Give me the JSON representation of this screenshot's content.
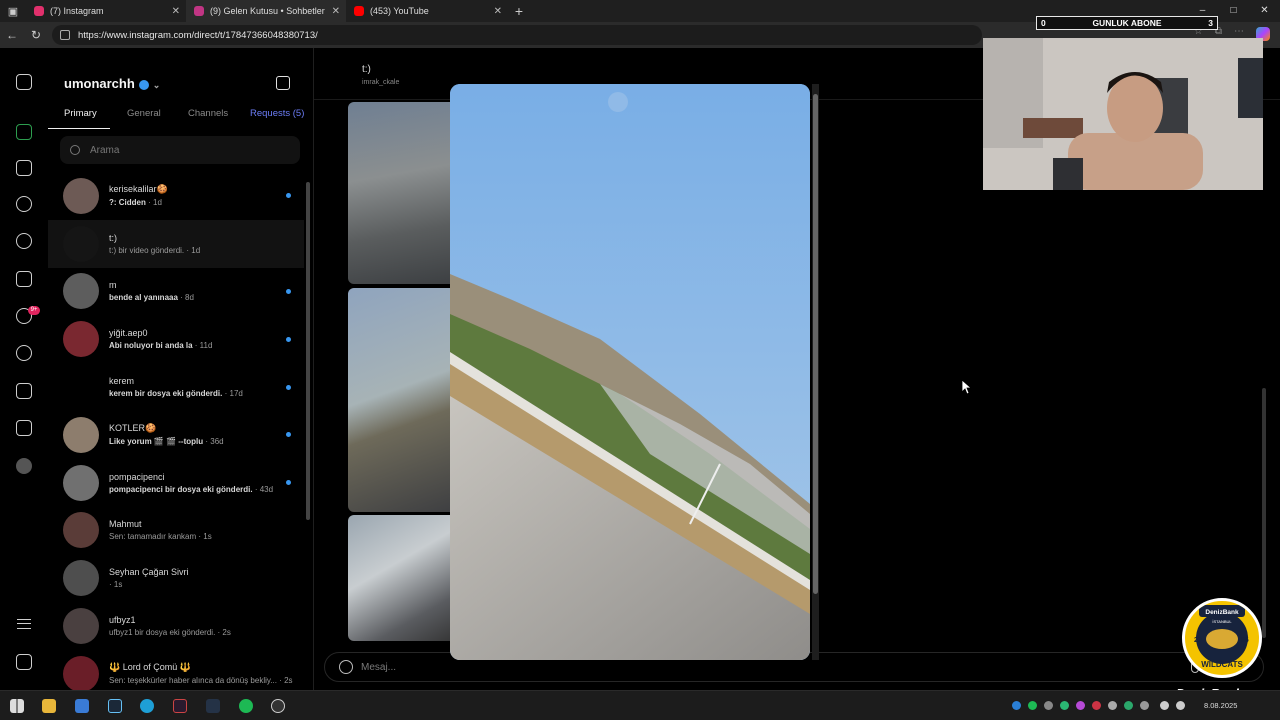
{
  "browser": {
    "tabs": [
      {
        "title": "(7) Instagram",
        "favicon_color": "#e1306c"
      },
      {
        "title": "(9) Gelen Kutusu • Sohbetler",
        "favicon_color": "#c13584"
      },
      {
        "title": "(453) YouTube",
        "favicon_color": "#ff0000"
      }
    ],
    "new_tab": "+",
    "url": "https://www.instagram.com/direct/t/17847366048380713/",
    "window_controls": {
      "minimize": "–",
      "maximize": "□",
      "close": "✕"
    }
  },
  "instagram": {
    "account_name": "umonarchh",
    "filters": {
      "primary": "Primary",
      "general": "General",
      "channels": "Channels",
      "requests": "Requests (5)"
    },
    "search_placeholder": "Arama",
    "notification_badge": "9+",
    "conversations": [
      {
        "name": "kerisekalilar🍪",
        "preview": "?: Cidden",
        "time": "· 1d",
        "unread": true,
        "bold_preview": true,
        "avatar_color": "#6d5a55"
      },
      {
        "name": "t:)",
        "preview": "t:) bir video gönderdi.",
        "time": "· 1d",
        "unread": false,
        "bold_preview": false,
        "avatar_color": "#151515",
        "selected": true
      },
      {
        "name": "m",
        "preview": "bende al yanınaaa",
        "time": "· 8d",
        "unread": true,
        "bold_preview": true,
        "avatar_color": "#5d5d5d"
      },
      {
        "name": "yiğit.aep0",
        "preview": "Abi noluyor bi anda la",
        "time": "· 11d",
        "unread": true,
        "bold_preview": true,
        "avatar_color": "#7a2830"
      },
      {
        "name": "kerem",
        "preview": "kerem bir dosya eki gönderdi.",
        "time": "· 17d",
        "unread": true,
        "bold_preview": true,
        "avatar_color": "#000000"
      },
      {
        "name": "KOTLER🍪",
        "preview": "Like yorum 🎬 🎬 --toplu",
        "time": "· 36d",
        "unread": true,
        "bold_preview": true,
        "avatar_color": "#8d7d6d"
      },
      {
        "name": "pompacipenci",
        "preview": "pompacipenci bir dosya eki gönderdi.",
        "time": "· 43d",
        "unread": true,
        "bold_preview": true,
        "avatar_color": "#707070"
      },
      {
        "name": "Mahmut",
        "preview": "Sen: tamamadır kankam",
        "time": "· 1s",
        "unread": false,
        "bold_preview": false,
        "avatar_color": "#5a3c38"
      },
      {
        "name": "Seyhan Çağan Sivri",
        "preview": "",
        "time": "· 1s",
        "unread": false,
        "bold_preview": false,
        "avatar_color": "#4e4e4e"
      },
      {
        "name": "ufbyz1",
        "preview": "ufbyz1 bir dosya eki gönderdi.",
        "time": "· 2s",
        "unread": false,
        "bold_preview": false,
        "avatar_color": "#4a4040"
      },
      {
        "name": "🔱 Lord of Çomü 🔱",
        "preview": "Sen: teşekkürler haber alınca da dönüş bekliy...",
        "time": "· 2s",
        "unread": false,
        "bold_preview": false,
        "avatar_color": "#6a1e28"
      }
    ],
    "chat": {
      "title": "t:)",
      "subtitle": "imrak_ckale",
      "composer_placeholder": "Mesaj..."
    }
  },
  "overlay": {
    "abone_label": "GUNLUK ABONE",
    "abone_left": "0",
    "abone_right": "3",
    "sponsor_badge_text": "DenizBank",
    "sponsor_badge_city": "İSTANBUL",
    "sponsor_badge_year_left": "20",
    "sponsor_badge_year_right": "06",
    "sponsor_badge_team": "WILDCATS",
    "sponsor_logo": "DenizBank"
  },
  "taskbar": {
    "time": "",
    "date": "8.08.2025"
  },
  "colors": {
    "accent_blue": "#3897f0",
    "requests_blue": "#6b7cf5",
    "badge_red": "#e0245e",
    "sky": "#7fb0e4"
  }
}
